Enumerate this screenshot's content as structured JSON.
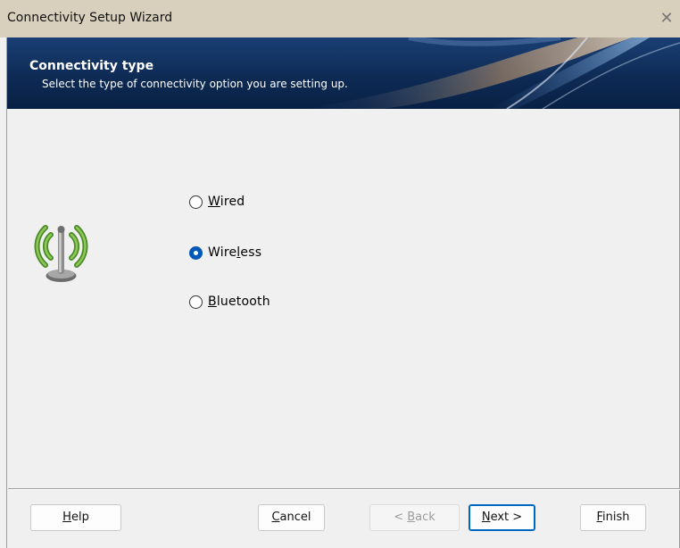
{
  "window": {
    "title": "Connectivity Setup Wizard",
    "close_glyph": "✕"
  },
  "header": {
    "title": "Connectivity type",
    "subtitle": "Select the type of connectivity option you are setting up."
  },
  "icon": "wireless-antenna-icon",
  "options": [
    {
      "key": "wired",
      "pre": "",
      "accel": "W",
      "post": "ired",
      "checked": false
    },
    {
      "key": "wireless",
      "pre": "Wire",
      "accel": "l",
      "post": "ess",
      "checked": true
    },
    {
      "key": "bluetooth",
      "pre": "",
      "accel": "B",
      "post": "luetooth",
      "checked": false
    }
  ],
  "buttons": {
    "help": {
      "pre": "",
      "accel": "H",
      "post": "elp"
    },
    "cancel": {
      "pre": "",
      "accel": "C",
      "post": "ancel"
    },
    "back": {
      "pre": "< ",
      "accel": "B",
      "post": "ack",
      "disabled": true
    },
    "next": {
      "pre": "",
      "accel": "N",
      "post": "ext >",
      "default": true
    },
    "finish": {
      "pre": "",
      "accel": "F",
      "post": "inish"
    }
  },
  "colors": {
    "banner": "#0e2b55",
    "radio_selected": "#0058b8",
    "antenna_green": "#5a9a2e"
  }
}
